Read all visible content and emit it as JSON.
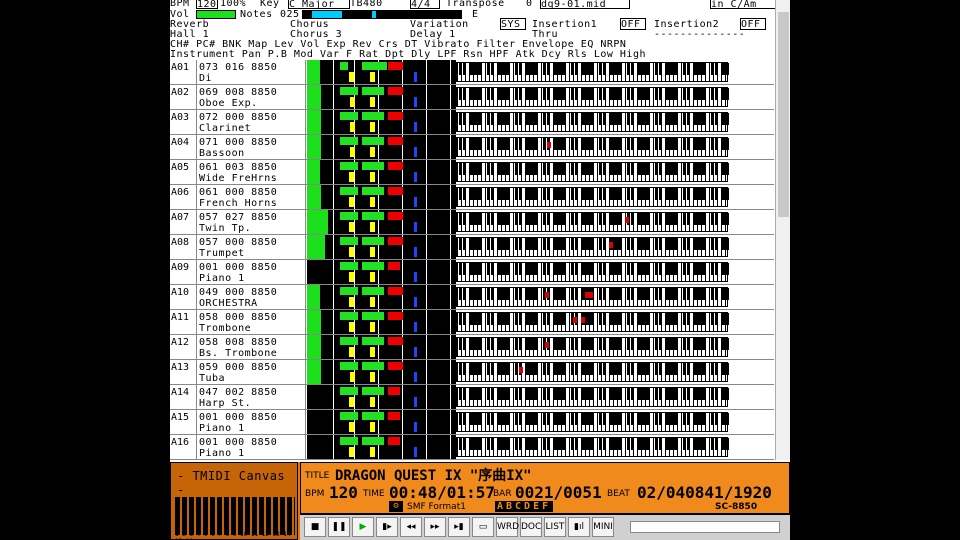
{
  "top": {
    "bpm_label": "BPM",
    "bpm": "120",
    "pct": "100%",
    "key_label": "Key",
    "key": "C Major",
    "tb": "TB480",
    "sig": "4/4",
    "transpose_label": "Transpose",
    "transpose": "0",
    "file": "dq9-01.mid",
    "keymode": "in C/Am",
    "vol_label": "Vol",
    "notes_label": "Notes",
    "notes": "025",
    "e_label": "E",
    "reverb_label": "Reverb",
    "reverb": "Hall 1",
    "chorus_label": "Chorus",
    "chorus": "Chorus 3",
    "variation_label": "Variation",
    "variation": "Delay 1",
    "sys": "SYS",
    "ins1_label": "Insertion1",
    "ins1": "OFF",
    "ins1_val": "Thru",
    "ins2_label": "Insertion2",
    "ins2": "OFF",
    "ins2_val": "--------------"
  },
  "headers": {
    "line1": "CH# PC# BNK Map  Lev Vol Exp Rev Crs DT   Vibrato     Filter   Envelope  EQ   NRPN",
    "line2": "    Instrument            Pan P.B Mod Var F  Rat Dpt Dly LPF Rsn HPF Atk Dcy Rls Low  High"
  },
  "channels": [
    {
      "ch": "A01",
      "code": "073 016 8850",
      "name": "Di",
      "lev": 0.5,
      "vol": 0.2,
      "pan": 0.3,
      "exp": 0.7,
      "rev": 0.75,
      "notes": []
    },
    {
      "ch": "A02",
      "code": "069 008 8850",
      "name": "Oboe Exp.",
      "lev": 0.55,
      "vol": 0.45,
      "pan": 0.35,
      "exp": 0.6,
      "rev": 0.75,
      "notes": []
    },
    {
      "ch": "A03",
      "code": "072 000 8850",
      "name": "Clarinet",
      "lev": 0.55,
      "vol": 0.45,
      "pan": 0.35,
      "exp": 0.6,
      "rev": 0.75,
      "notes": []
    },
    {
      "ch": "A04",
      "code": "071 000 8850",
      "name": "Bassoon",
      "lev": 0.55,
      "vol": 0.45,
      "pan": 0.35,
      "exp": 0.6,
      "rev": 0.75,
      "notes": [
        90
      ]
    },
    {
      "ch": "A05",
      "code": "061 003 8850",
      "name": "Wide FreHrns",
      "lev": 0.5,
      "vol": 0.45,
      "pan": 0.3,
      "exp": 0.6,
      "rev": 0.75,
      "notes": []
    },
    {
      "ch": "A06",
      "code": "061 000 8850",
      "name": "French Horns",
      "lev": 0.55,
      "vol": 0.45,
      "pan": 0.3,
      "exp": 0.6,
      "rev": 0.75,
      "notes": []
    },
    {
      "ch": "A07",
      "code": "057 027 8850",
      "name": "Twin Tp.",
      "lev": 0.8,
      "vol": 0.45,
      "pan": 0.3,
      "exp": 0.6,
      "rev": 0.75,
      "notes": [
        168
      ]
    },
    {
      "ch": "A08",
      "code": "057 000 8850",
      "name": "Trumpet",
      "lev": 0.7,
      "vol": 0.45,
      "pan": 0.3,
      "exp": 0.6,
      "rev": 0.75,
      "notes": [
        152
      ]
    },
    {
      "ch": "A09",
      "code": "001 000 8850",
      "name": "Piano 1",
      "lev": 0,
      "vol": 0.45,
      "pan": 0.3,
      "exp": 0.6,
      "rev": 0.6,
      "notes": []
    },
    {
      "ch": "A10",
      "code": "049 000 8850",
      "name": "ORCHESTRA",
      "lev": 0.5,
      "vol": 0.45,
      "pan": 0.3,
      "exp": 0.6,
      "rev": 0.75,
      "notes": [
        88,
        128,
        132
      ]
    },
    {
      "ch": "A11",
      "code": "058 000 8850",
      "name": "Trombone",
      "lev": 0.55,
      "vol": 0.45,
      "pan": 0.3,
      "exp": 0.6,
      "rev": 0.75,
      "notes": [
        116,
        124
      ]
    },
    {
      "ch": "A12",
      "code": "058 008 8850",
      "name": "Bs. Trombone",
      "lev": 0.55,
      "vol": 0.45,
      "pan": 0.3,
      "exp": 0.6,
      "rev": 0.75,
      "notes": [
        88
      ]
    },
    {
      "ch": "A13",
      "code": "059 000 8850",
      "name": "Tuba",
      "lev": 0.55,
      "vol": 0.45,
      "pan": 0.35,
      "exp": 0.6,
      "rev": 0.75,
      "notes": [
        62
      ]
    },
    {
      "ch": "A14",
      "code": "047 002 8850",
      "name": "Harp St.",
      "lev": 0,
      "vol": 0.45,
      "pan": 0.3,
      "exp": 0.6,
      "rev": 0.6,
      "notes": []
    },
    {
      "ch": "A15",
      "code": "001 000 8850",
      "name": "Piano 1",
      "lev": 0,
      "vol": 0.45,
      "pan": 0.3,
      "exp": 0.6,
      "rev": 0.6,
      "notes": []
    },
    {
      "ch": "A16",
      "code": "001 000 8850",
      "name": "Piano 1",
      "lev": 0,
      "vol": 0.45,
      "pan": 0.3,
      "exp": 0.6,
      "rev": 0.6,
      "notes": []
    }
  ],
  "bottom": {
    "app_title": "- TMIDI Canvas -",
    "title_label": "TITLE",
    "song_title": "DRAGON QUEST IX \"序曲IX\"",
    "bpm_label": "BPM",
    "bpm": "120",
    "time_label": "TIME",
    "time": "00:48/01:57",
    "bar_label": "BAR",
    "bar": "0021/0051",
    "beat_label": "BEAT",
    "beat": "02/040841/1920",
    "format": "SMF Format1",
    "ports": "ABCDEF",
    "module": "SC-8850",
    "buttons": [
      "■",
      "❚❚",
      "▶",
      "▮▸",
      "◂◂",
      "▸▸",
      "▸▮",
      "▭",
      "WRD",
      "DOC",
      "LIST",
      "▮ıl",
      "MINI"
    ]
  },
  "colors": {
    "accent": "#e07a10",
    "level": "#1de01d",
    "note": "#dd0000"
  }
}
